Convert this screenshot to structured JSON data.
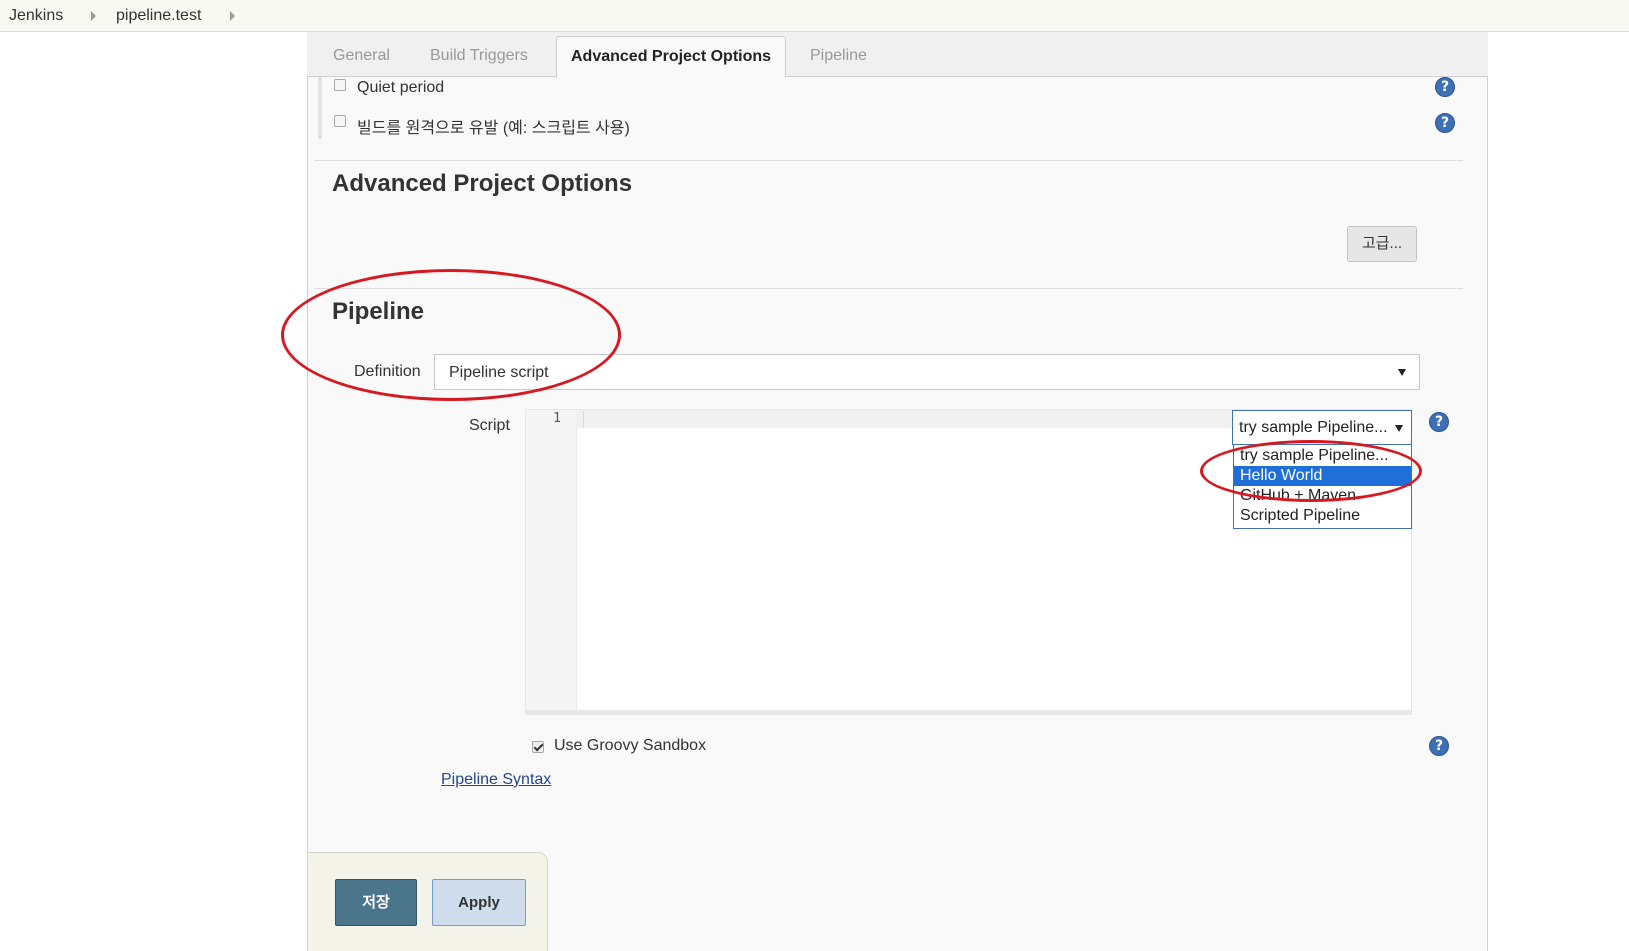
{
  "breadcrumb": {
    "items": [
      "Jenkins",
      "pipeline.test"
    ]
  },
  "tabs": [
    {
      "label": "General",
      "active": false
    },
    {
      "label": "Build Triggers",
      "active": false
    },
    {
      "label": "Advanced Project Options",
      "active": true
    },
    {
      "label": "Pipeline",
      "active": false
    }
  ],
  "build_triggers": {
    "quiet_period_label": "Quiet period",
    "quiet_period_checked": false,
    "remote_trigger_label": "빌드를 원격으로 유발 (예: 스크립트 사용)",
    "remote_trigger_checked": false
  },
  "advanced_section": {
    "title": "Advanced Project Options",
    "advanced_button": "고급..."
  },
  "pipeline_section": {
    "title": "Pipeline",
    "definition_label": "Definition",
    "definition_value": "Pipeline script",
    "script_label": "Script",
    "line_number": "1",
    "sample_select_value": "try sample Pipeline...",
    "sample_options": [
      {
        "label": "try sample Pipeline...",
        "selected": false
      },
      {
        "label": "Hello World",
        "selected": true
      },
      {
        "label": "GitHub + Maven",
        "selected": false
      },
      {
        "label": "Scripted Pipeline",
        "selected": false
      }
    ],
    "groovy_sandbox_label": "Use Groovy Sandbox",
    "groovy_sandbox_checked": true,
    "pipeline_syntax_link": "Pipeline Syntax"
  },
  "footer": {
    "save_label": "저장",
    "apply_label": "Apply"
  },
  "icons": {
    "help": "help-icon",
    "breadcrumb_separator": "chevron-right-icon",
    "dropdown_caret": "caret-down-icon"
  },
  "colors": {
    "accent_blue": "#3f6fb5",
    "selected_option": "#1e6fd9",
    "save_button": "#4b758b",
    "apply_button": "#cfdcec",
    "annotation_red": "#d81820",
    "link": "#24478f"
  }
}
